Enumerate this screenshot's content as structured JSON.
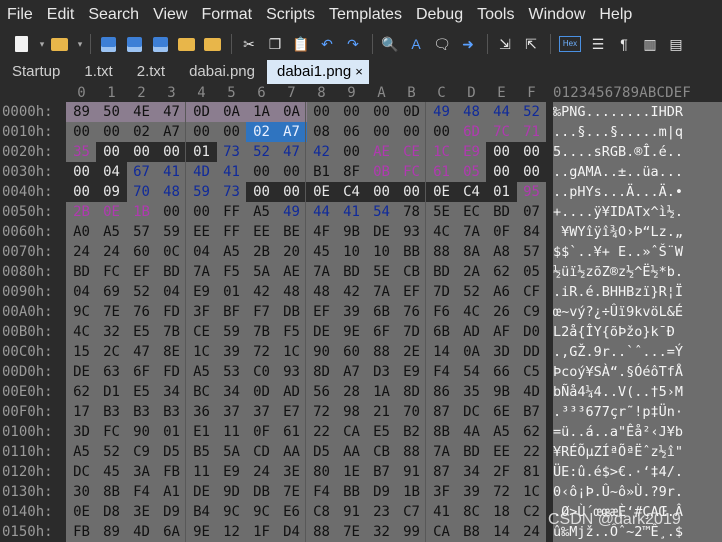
{
  "menu": [
    "File",
    "Edit",
    "Search",
    "View",
    "Format",
    "Scripts",
    "Templates",
    "Debug",
    "Tools",
    "Window",
    "Help"
  ],
  "toolbar_icons": [
    {
      "name": "new-file-icon",
      "glyph": "page"
    },
    {
      "name": "new-file-dropdown-icon",
      "glyph": "▾"
    },
    {
      "name": "open-folder-icon",
      "glyph": "folder"
    },
    {
      "name": "open-dropdown-icon",
      "glyph": "▾"
    },
    {
      "name": "save-icon",
      "glyph": "disk"
    },
    {
      "name": "save-as-icon",
      "glyph": "disk"
    },
    {
      "name": "save-all-icon",
      "glyph": "disk"
    },
    {
      "name": "open-project-icon",
      "glyph": "folder"
    },
    {
      "name": "open-workspace-icon",
      "glyph": "folder"
    },
    {
      "name": "cut-icon",
      "glyph": "✂"
    },
    {
      "name": "copy-icon",
      "glyph": "❐"
    },
    {
      "name": "paste-icon",
      "glyph": "📋"
    },
    {
      "name": "undo-icon",
      "glyph": "↶"
    },
    {
      "name": "redo-icon",
      "glyph": "↷"
    },
    {
      "name": "find-icon",
      "glyph": "🔍"
    },
    {
      "name": "replace-icon",
      "glyph": "A"
    },
    {
      "name": "find-in-files-icon",
      "glyph": "🗨"
    },
    {
      "name": "goto-icon",
      "glyph": "➜"
    },
    {
      "name": "insert-icon",
      "glyph": "⇲"
    },
    {
      "name": "overwrite-icon",
      "glyph": "⇱"
    },
    {
      "name": "hex-mode-icon",
      "glyph": "Hex"
    },
    {
      "name": "text-mode-icon",
      "glyph": "☰"
    },
    {
      "name": "show-whitespace-icon",
      "glyph": "¶"
    },
    {
      "name": "columns-icon",
      "glyph": "▥"
    },
    {
      "name": "wrap-icon",
      "glyph": "▤"
    }
  ],
  "tabs": [
    {
      "label": "Startup",
      "active": false
    },
    {
      "label": "1.txt",
      "active": false
    },
    {
      "label": "2.txt",
      "active": false
    },
    {
      "label": "dabai.png",
      "active": false
    },
    {
      "label": "dabai1.png",
      "active": true
    }
  ],
  "tab_close_glyph": "×",
  "column_headers": [
    "0",
    "1",
    "2",
    "3",
    "4",
    "5",
    "6",
    "7",
    "8",
    "9",
    "A",
    "B",
    "C",
    "D",
    "E",
    "F"
  ],
  "ascii_header": "0123456789ABCDEF",
  "colors": {
    "addr": "#9a9a9a",
    "hex_bg": "#6d6d6d",
    "purple_bg": "#8a7a8c",
    "selection": "#2f74c0",
    "blue_text": "#102a9a",
    "magenta_text": "#b03ab0",
    "dark_bg": "#2b2b2b"
  },
  "rows": [
    {
      "addr": "0000h:",
      "bytes": [
        "89",
        "50",
        "4E",
        "47",
        "0D",
        "0A",
        "1A",
        "0A",
        "00",
        "00",
        "00",
        "0D",
        "49",
        "48",
        "44",
        "52"
      ],
      "ascii": "‰PNG........IHDR"
    },
    {
      "addr": "0010h:",
      "bytes": [
        "00",
        "00",
        "02",
        "A7",
        "00",
        "00",
        "02",
        "A7",
        "08",
        "06",
        "00",
        "00",
        "00",
        "6D",
        "7C",
        "71"
      ],
      "ascii": "...§...§.....m|q"
    },
    {
      "addr": "0020h:",
      "bytes": [
        "35",
        "00",
        "00",
        "00",
        "01",
        "73",
        "52",
        "47",
        "42",
        "00",
        "AE",
        "CE",
        "1C",
        "E9",
        "00",
        "00"
      ],
      "ascii": "5....sRGB.®Î.é.."
    },
    {
      "addr": "0030h:",
      "bytes": [
        "00",
        "04",
        "67",
        "41",
        "4D",
        "41",
        "00",
        "00",
        "B1",
        "8F",
        "0B",
        "FC",
        "61",
        "05",
        "00",
        "00"
      ],
      "ascii": "..gAMA..±..üa..."
    },
    {
      "addr": "0040h:",
      "bytes": [
        "00",
        "09",
        "70",
        "48",
        "59",
        "73",
        "00",
        "00",
        "0E",
        "C4",
        "00",
        "00",
        "0E",
        "C4",
        "01",
        "95"
      ],
      "ascii": "..pHYs...Ä...Ä.•"
    },
    {
      "addr": "0050h:",
      "bytes": [
        "2B",
        "0E",
        "1B",
        "00",
        "00",
        "FF",
        "A5",
        "49",
        "44",
        "41",
        "54",
        "78",
        "5E",
        "EC",
        "BD",
        "07"
      ],
      "ascii": "+....ÿ¥IDATx^ì½."
    },
    {
      "addr": "0060h:",
      "bytes": [
        "A0",
        "A5",
        "57",
        "59",
        "EE",
        "FF",
        "EE",
        "BE",
        "4F",
        "9B",
        "DE",
        "93",
        "4C",
        "7A",
        "0F",
        "84"
      ],
      "ascii": " ¥WYîÿî¾O›Þ“Lz.„"
    },
    {
      "addr": "0070h:",
      "bytes": [
        "24",
        "24",
        "60",
        "0C",
        "04",
        "A5",
        "2B",
        "20",
        "45",
        "10",
        "10",
        "BB",
        "88",
        "8A",
        "A8",
        "57"
      ],
      "ascii": "$$`..¥+ E..»ˆŠ¨W"
    },
    {
      "addr": "0080h:",
      "bytes": [
        "BD",
        "FC",
        "EF",
        "BD",
        "7A",
        "F5",
        "5A",
        "AE",
        "7A",
        "BD",
        "5E",
        "CB",
        "BD",
        "2A",
        "62",
        "05"
      ],
      "ascii": "½üï½zõZ®z½^Ë½*b."
    },
    {
      "addr": "0090h:",
      "bytes": [
        "04",
        "69",
        "52",
        "04",
        "E9",
        "01",
        "42",
        "48",
        "48",
        "42",
        "7A",
        "EF",
        "7D",
        "52",
        "A6",
        "CF"
      ],
      "ascii": ".iR.é.BHHBzï}R¦Ï"
    },
    {
      "addr": "00A0h:",
      "bytes": [
        "9C",
        "7E",
        "76",
        "FD",
        "3F",
        "BF",
        "F7",
        "DB",
        "EF",
        "39",
        "6B",
        "76",
        "F6",
        "4C",
        "26",
        "C9"
      ],
      "ascii": "œ~vý?¿÷Ûï9kvöL&É"
    },
    {
      "addr": "00B0h:",
      "bytes": [
        "4C",
        "32",
        "E5",
        "7B",
        "CE",
        "59",
        "7B",
        "F5",
        "DE",
        "9E",
        "6F",
        "7D",
        "6B",
        "AD",
        "AF",
        "D0"
      ],
      "ascii": "L2å{ÎY{õÞžo}k­¯Ð"
    },
    {
      "addr": "00C0h:",
      "bytes": [
        "15",
        "2C",
        "47",
        "8E",
        "1C",
        "39",
        "72",
        "1C",
        "90",
        "60",
        "88",
        "2E",
        "14",
        "0A",
        "3D",
        "DD"
      ],
      "ascii": ".,GŽ.9r..`ˆ...=Ý"
    },
    {
      "addr": "00D0h:",
      "bytes": [
        "DE",
        "63",
        "6F",
        "FD",
        "A5",
        "53",
        "C0",
        "93",
        "8D",
        "A7",
        "D3",
        "E9",
        "F4",
        "54",
        "66",
        "C5"
      ],
      "ascii": "Þcoý¥SÀ“.§ÓéôTfÅ"
    },
    {
      "addr": "00E0h:",
      "bytes": [
        "62",
        "D1",
        "E5",
        "34",
        "BC",
        "34",
        "0D",
        "AD",
        "56",
        "28",
        "1A",
        "8D",
        "86",
        "35",
        "9B",
        "4D"
      ],
      "ascii": "bÑå4¼4..V(..†5›M"
    },
    {
      "addr": "00F0h:",
      "bytes": [
        "17",
        "B3",
        "B3",
        "B3",
        "36",
        "37",
        "37",
        "E7",
        "72",
        "98",
        "21",
        "70",
        "87",
        "DC",
        "6E",
        "B7"
      ],
      "ascii": ".³³³677çr˜!p‡Ün·"
    },
    {
      "addr": "0100h:",
      "bytes": [
        "3D",
        "FC",
        "90",
        "01",
        "E1",
        "11",
        "0F",
        "61",
        "22",
        "CA",
        "E5",
        "B2",
        "8B",
        "4A",
        "A5",
        "62"
      ],
      "ascii": "=ü..á..a\"Êå²‹J¥b"
    },
    {
      "addr": "0110h:",
      "bytes": [
        "A5",
        "52",
        "C9",
        "D5",
        "B5",
        "5A",
        "CD",
        "AA",
        "D5",
        "AA",
        "CB",
        "88",
        "7A",
        "BD",
        "EE",
        "22"
      ],
      "ascii": "¥RÉÕµZÍªÕªËˆz½î\""
    },
    {
      "addr": "0120h:",
      "bytes": [
        "DC",
        "45",
        "3A",
        "FB",
        "11",
        "E9",
        "24",
        "3E",
        "80",
        "1E",
        "B7",
        "91",
        "87",
        "34",
        "2F",
        "81"
      ],
      "ascii": "ÜE:û.é$>€.·‘‡4/."
    },
    {
      "addr": "0130h:",
      "bytes": [
        "30",
        "8B",
        "F4",
        "A1",
        "DE",
        "9D",
        "DB",
        "7E",
        "F4",
        "BB",
        "D9",
        "1B",
        "3F",
        "39",
        "72",
        "1C"
      ],
      "ascii": "0‹ô¡Þ.Û~ô»Ù.?9r."
    },
    {
      "addr": "0140h:",
      "bytes": [
        "0E",
        "D8",
        "3E",
        "D9",
        "B4",
        "9C",
        "9C",
        "E6",
        "C8",
        "91",
        "23",
        "C7",
        "41",
        "8C",
        "18",
        "C2"
      ],
      "ascii": ".Ø>Ù´œœæÈ‘#ÇAŒ.Â"
    },
    {
      "addr": "0150h:",
      "bytes": [
        "FB",
        "89",
        "4D",
        "6A",
        "9E",
        "12",
        "1F",
        "D4",
        "88",
        "7E",
        "32",
        "99",
        "CA",
        "B8",
        "14",
        "24"
      ],
      "ascii": "û‰Mjž..Ôˆ~2™Ê¸.$"
    }
  ],
  "watermark": "CSDN @dark2019"
}
